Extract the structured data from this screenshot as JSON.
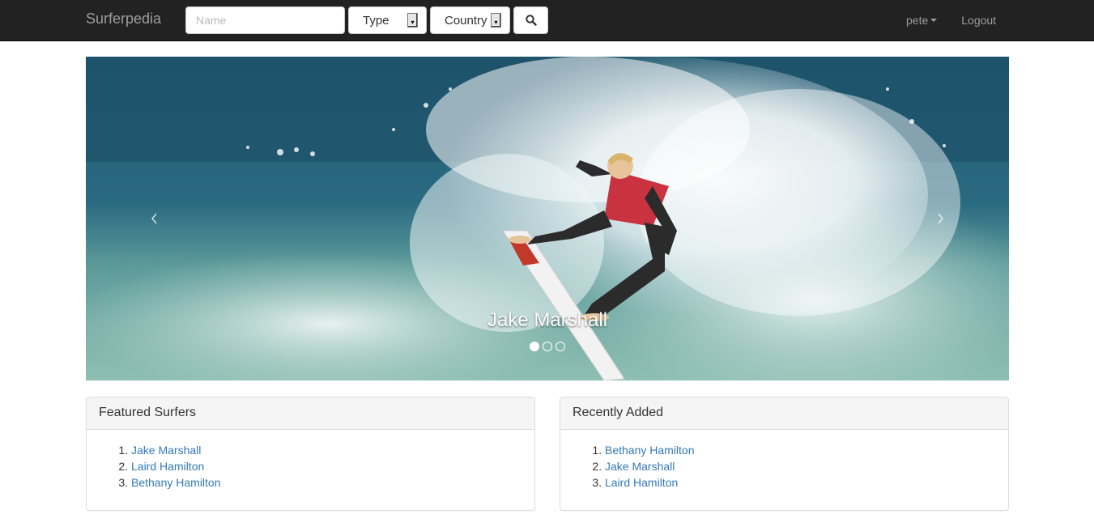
{
  "navbar": {
    "brand": "Surferpedia",
    "name_placeholder": "Name",
    "type_label": "Type",
    "country_label": "Country",
    "search_icon": "search-icon",
    "user": "pete",
    "logout": "Logout"
  },
  "carousel": {
    "caption": "Jake Marshall",
    "indicators": 3,
    "active_index": 0
  },
  "featured": {
    "title": "Featured Surfers",
    "items": [
      {
        "num": "1.",
        "name": "Jake Marshall"
      },
      {
        "num": "2.",
        "name": "Laird Hamilton"
      },
      {
        "num": "3.",
        "name": "Bethany Hamilton"
      }
    ]
  },
  "recent": {
    "title": "Recently Added",
    "items": [
      {
        "num": "1.",
        "name": "Bethany Hamilton"
      },
      {
        "num": "2.",
        "name": "Jake Marshall"
      },
      {
        "num": "3.",
        "name": "Laird Hamilton"
      }
    ]
  },
  "colors": {
    "navbar_bg": "#222222",
    "navbar_text": "#9d9d9d",
    "link": "#337ab7",
    "panel_heading_bg": "#f5f5f5"
  }
}
